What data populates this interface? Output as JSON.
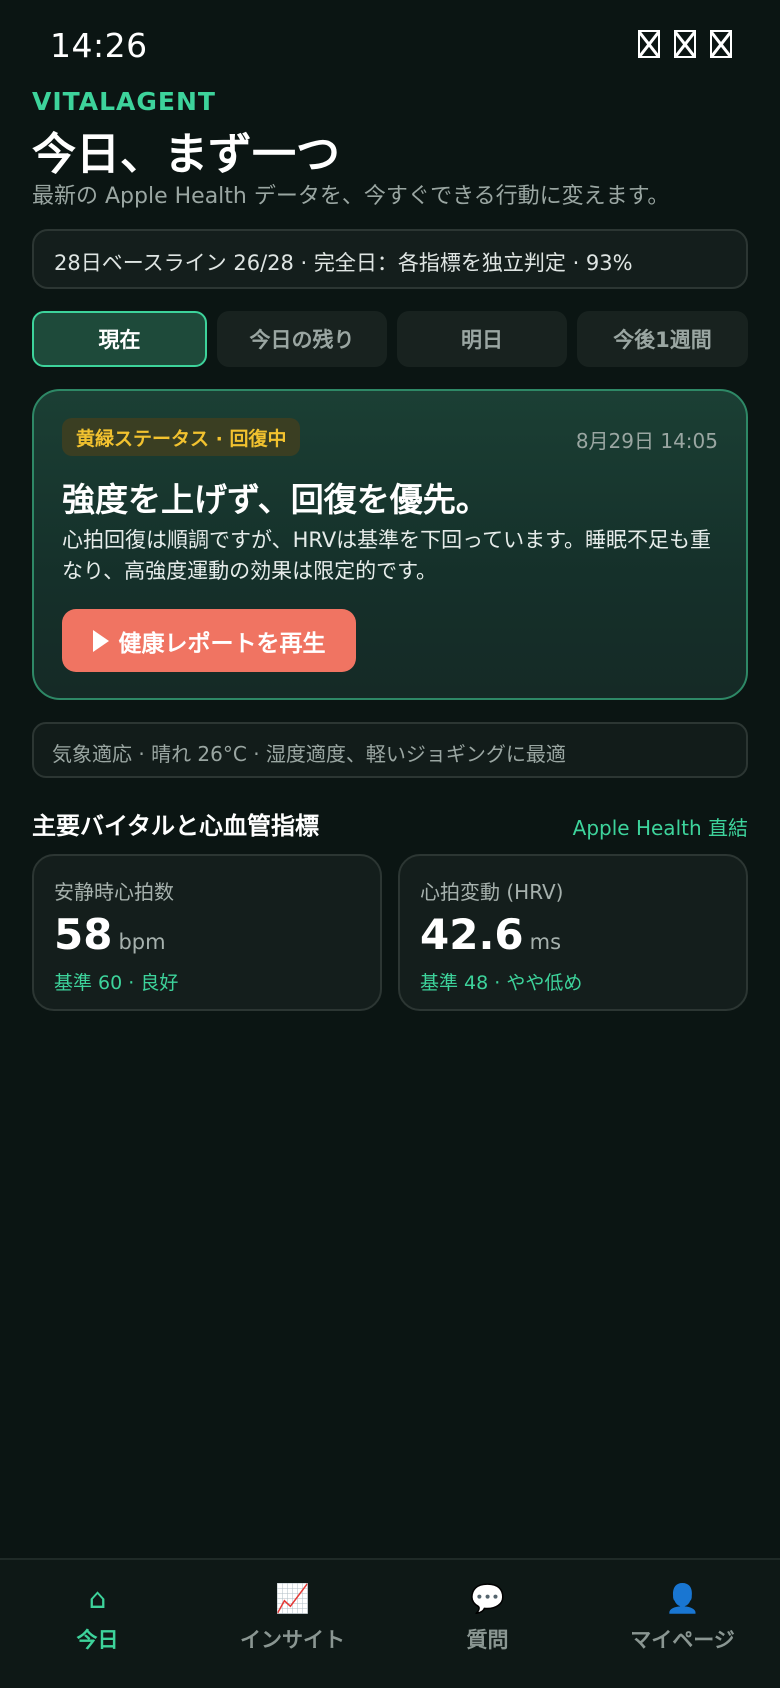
{
  "status_bar": {
    "time": "14:26",
    "icons": [
      "signal-icon",
      "wifi-icon",
      "battery-icon"
    ]
  },
  "header": {
    "brand": "VITALAGENT",
    "title": "今日、まず一つ",
    "subtitle": "最新の Apple Health データを、今すぐできる行動に変えます。"
  },
  "baseline_text": "28日ベースライン 26/28 · 完全日：各指標を独立判定 · 93%",
  "tabs": [
    {
      "label": "現在",
      "active": true
    },
    {
      "label": "今日の残り",
      "active": false
    },
    {
      "label": "明日",
      "active": false
    },
    {
      "label": "今後1週間",
      "active": false
    }
  ],
  "hero": {
    "badge": "黄緑ステータス · 回復中",
    "time": "8月29日 14:05",
    "title": "強度を上げず、回復を優先。",
    "body": "心拍回復は順調ですが、HRVは基準を下回っています。睡眠不足も重なり、高強度運動の効果は限定的です。",
    "play_label": "健康レポートを再生"
  },
  "weather_text": "気象適応 · 晴れ 26°C · 湿度適度、軽いジョギングに最適",
  "vitals_section": {
    "title": "主要バイタルと心血管指標",
    "link": "Apple Health 直結",
    "items": [
      {
        "label": "安静時心拍数",
        "value": "58",
        "unit": "bpm",
        "note": "基準 60 · 良好"
      },
      {
        "label": "心拍変動 (HRV)",
        "value": "42.6",
        "unit": "ms",
        "note": "基準 48 · やや低め"
      }
    ]
  },
  "nav": {
    "items": [
      {
        "label": "今日",
        "icon": "home-icon",
        "glyph": "⌂",
        "active": true
      },
      {
        "label": "インサイト",
        "icon": "chart-icon",
        "glyph": "📈",
        "active": false
      },
      {
        "label": "質問",
        "icon": "chat-icon",
        "glyph": "💬",
        "active": false
      },
      {
        "label": "マイページ",
        "icon": "profile-icon",
        "glyph": "👤",
        "active": false
      }
    ]
  },
  "colors": {
    "background": "#0b1513",
    "accent": "#3dd39b",
    "warning": "#f2c22f",
    "play_button": "#f07462"
  }
}
